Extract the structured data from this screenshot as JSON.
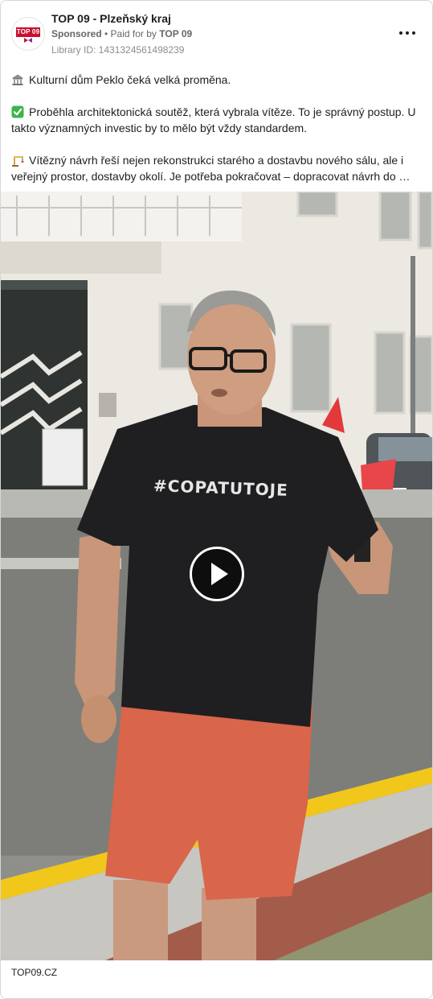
{
  "header": {
    "page_name": "TOP 09 - Plzeňský kraj",
    "sponsored_label": "Sponsored",
    "separator": " • ",
    "paid_for_prefix": "Paid for by ",
    "paid_for_name": "TOP 09",
    "library_id": "Library ID: 1431324561498239",
    "avatar_logo_text": "TOP 09",
    "more_icon": "more-horizontal-icon"
  },
  "body": {
    "paragraphs": [
      {
        "icon": "building-emoji",
        "text": "Kulturní dům Peklo čeká velká proměna."
      },
      {
        "icon": "check-mark-emoji",
        "text": "Proběhla architektonická soutěž, která vybrala vítěze. To je správný postup. U takto významných investic by to mělo být vždy standardem."
      },
      {
        "icon": "construction-emoji",
        "text": "Vítězný návrh řeší nejen rekonstrukci starého a dostavbu nového sálu, ale i veřejný prostor, dostavby okolí. Je potřeba pokračovat – dopracovat návrh do …"
      }
    ]
  },
  "media": {
    "shirt_text": "#COPATUTOJE",
    "play_icon": "play-icon"
  },
  "footer": {
    "link_caption": "TOP09.CZ"
  },
  "colors": {
    "text_primary": "#1c1e21",
    "text_secondary": "#65676b",
    "border": "#d4d6da",
    "brand_red": "#c8102e",
    "curb_yellow": "#f2c71c"
  }
}
